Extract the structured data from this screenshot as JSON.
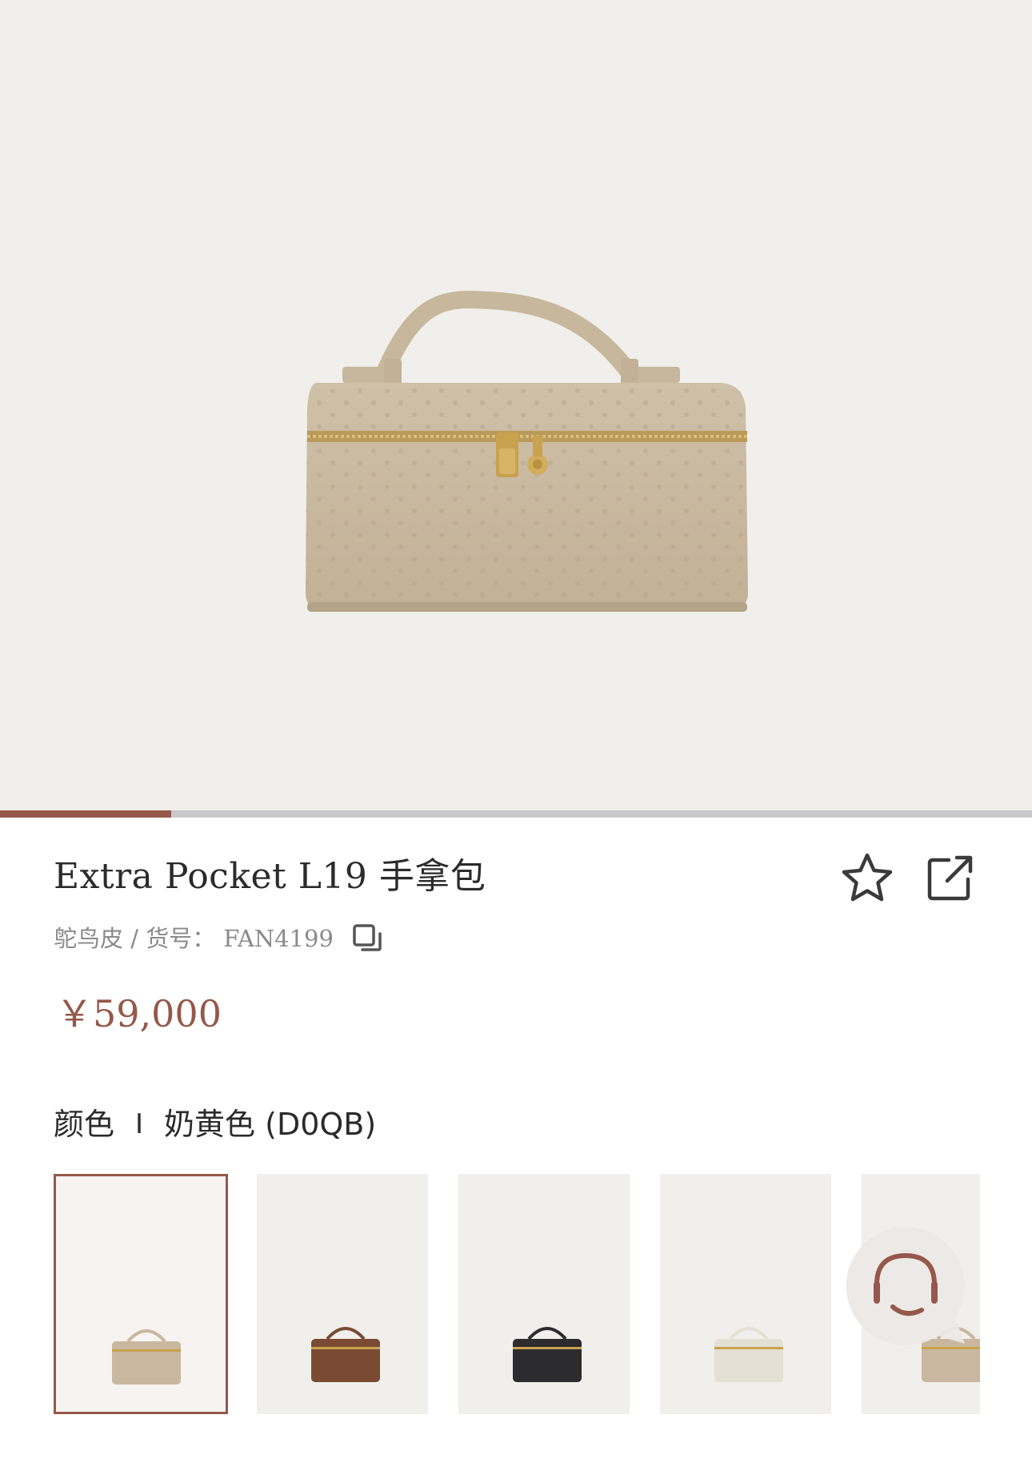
{
  "product": {
    "title": "Extra Pocket L19 手拿包",
    "material_sku": "鸵鸟皮 / 货号：",
    "sku": "FAN4199",
    "price": "￥59,000"
  },
  "gallery": {
    "progress": 0.166
  },
  "color": {
    "label": "颜色",
    "separator": "I",
    "selected": "奶黄色 (D0QB)"
  },
  "swatches": [
    {
      "bag_color": "#c9b89f",
      "selected": true
    },
    {
      "bag_color": "#7a4a33",
      "selected": false
    },
    {
      "bag_color": "#2c2c2e",
      "selected": false
    },
    {
      "bag_color": "#e4e0d3",
      "selected": false
    },
    {
      "bag_color": "#c9b89f",
      "selected": false
    }
  ],
  "icons": {
    "favorite": "star-icon",
    "share": "share-icon",
    "copy": "copy-icon",
    "service": "headset-icon"
  },
  "colors": {
    "accent": "#95584a",
    "hero_bg": "#f1efeb",
    "bag": "#c9b89f",
    "gold": "#c9a24f"
  }
}
